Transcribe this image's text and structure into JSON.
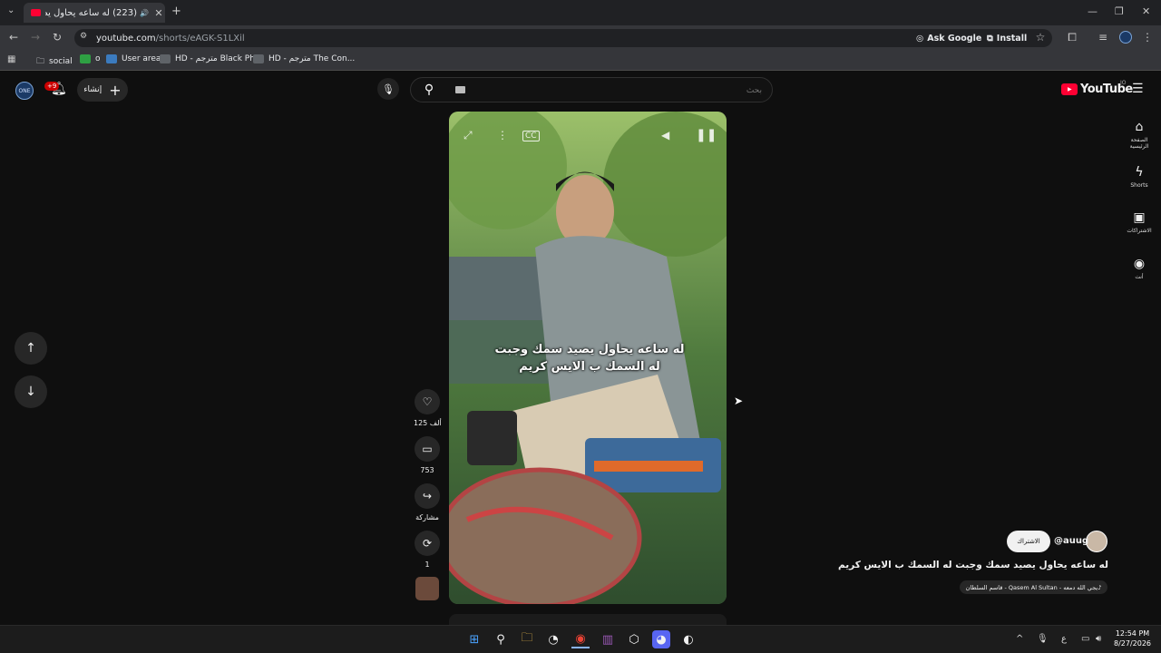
{
  "browser": {
    "tab_title": "(223) له ساعه يحاول يصيد س...",
    "url_host": "youtube.com",
    "url_path": "/shorts/eAGK-S1LXil",
    "ask_google": "Ask Google",
    "install": "Install",
    "bookmarks": [
      "social",
      "o",
      "User area",
      "HD - مترجم Black Ph...",
      "HD - مترجم The Con..."
    ]
  },
  "youtube": {
    "notifications_badge": "+9",
    "create_label": "إنشاء",
    "search_placeholder": "بحث",
    "logo_text": "YouTube",
    "country_code": "JO",
    "nav": {
      "home": "الصفحة الرئيسية",
      "shorts": "Shorts",
      "subscriptions": "الاشتراكات",
      "you": "أنت"
    }
  },
  "short": {
    "caption_line1": "له ساعه يحاول يصيد سمك وجبت",
    "caption_line2": "له السمك ب الايس كريم",
    "likes": "125 ألف",
    "comments": "753",
    "share_label": "مشاركة",
    "remix_count": "1",
    "channel_handle": "@auug",
    "subscribe_label": "الاشتراك",
    "title": "له ساعه يحاول يصيد سمك وجبت له السمك ب الايس كريم",
    "music": "يجي الله دمعه - Qasem Al Sultan - قاسم السلطان"
  },
  "taskbar": {
    "time": "12:54 PM",
    "date": "8/27/2026",
    "lang": "ع"
  },
  "colors": {
    "brand_red": "#ff0033",
    "background": "#0f0f0f"
  }
}
